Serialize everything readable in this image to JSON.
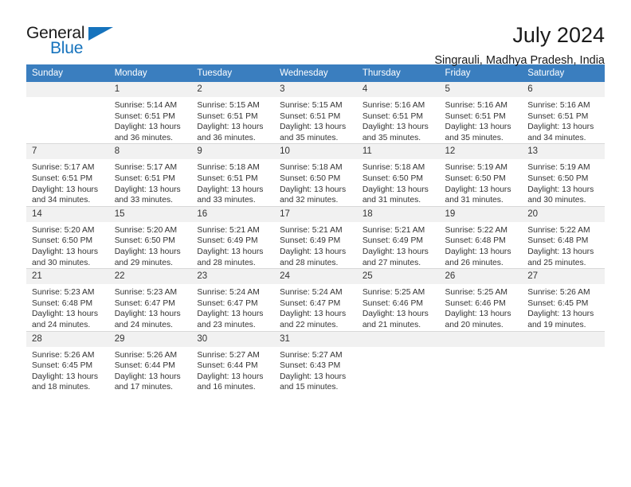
{
  "brand": {
    "word1": "General",
    "word2": "Blue",
    "triangle_color": "#1673bd"
  },
  "header": {
    "title": "July 2024",
    "subtitle": "Singrauli, Madhya Pradesh, India"
  },
  "calendar": {
    "header_bg": "#3a7ebf",
    "daynum_bg": "#f1f1f1",
    "weekdays": [
      "Sunday",
      "Monday",
      "Tuesday",
      "Wednesday",
      "Thursday",
      "Friday",
      "Saturday"
    ],
    "weeks": [
      [
        {
          "day": "",
          "lines": []
        },
        {
          "day": "1",
          "lines": [
            "Sunrise: 5:14 AM",
            "Sunset: 6:51 PM",
            "Daylight: 13 hours",
            "and 36 minutes."
          ]
        },
        {
          "day": "2",
          "lines": [
            "Sunrise: 5:15 AM",
            "Sunset: 6:51 PM",
            "Daylight: 13 hours",
            "and 36 minutes."
          ]
        },
        {
          "day": "3",
          "lines": [
            "Sunrise: 5:15 AM",
            "Sunset: 6:51 PM",
            "Daylight: 13 hours",
            "and 35 minutes."
          ]
        },
        {
          "day": "4",
          "lines": [
            "Sunrise: 5:16 AM",
            "Sunset: 6:51 PM",
            "Daylight: 13 hours",
            "and 35 minutes."
          ]
        },
        {
          "day": "5",
          "lines": [
            "Sunrise: 5:16 AM",
            "Sunset: 6:51 PM",
            "Daylight: 13 hours",
            "and 35 minutes."
          ]
        },
        {
          "day": "6",
          "lines": [
            "Sunrise: 5:16 AM",
            "Sunset: 6:51 PM",
            "Daylight: 13 hours",
            "and 34 minutes."
          ]
        }
      ],
      [
        {
          "day": "7",
          "lines": [
            "Sunrise: 5:17 AM",
            "Sunset: 6:51 PM",
            "Daylight: 13 hours",
            "and 34 minutes."
          ]
        },
        {
          "day": "8",
          "lines": [
            "Sunrise: 5:17 AM",
            "Sunset: 6:51 PM",
            "Daylight: 13 hours",
            "and 33 minutes."
          ]
        },
        {
          "day": "9",
          "lines": [
            "Sunrise: 5:18 AM",
            "Sunset: 6:51 PM",
            "Daylight: 13 hours",
            "and 33 minutes."
          ]
        },
        {
          "day": "10",
          "lines": [
            "Sunrise: 5:18 AM",
            "Sunset: 6:50 PM",
            "Daylight: 13 hours",
            "and 32 minutes."
          ]
        },
        {
          "day": "11",
          "lines": [
            "Sunrise: 5:18 AM",
            "Sunset: 6:50 PM",
            "Daylight: 13 hours",
            "and 31 minutes."
          ]
        },
        {
          "day": "12",
          "lines": [
            "Sunrise: 5:19 AM",
            "Sunset: 6:50 PM",
            "Daylight: 13 hours",
            "and 31 minutes."
          ]
        },
        {
          "day": "13",
          "lines": [
            "Sunrise: 5:19 AM",
            "Sunset: 6:50 PM",
            "Daylight: 13 hours",
            "and 30 minutes."
          ]
        }
      ],
      [
        {
          "day": "14",
          "lines": [
            "Sunrise: 5:20 AM",
            "Sunset: 6:50 PM",
            "Daylight: 13 hours",
            "and 30 minutes."
          ]
        },
        {
          "day": "15",
          "lines": [
            "Sunrise: 5:20 AM",
            "Sunset: 6:50 PM",
            "Daylight: 13 hours",
            "and 29 minutes."
          ]
        },
        {
          "day": "16",
          "lines": [
            "Sunrise: 5:21 AM",
            "Sunset: 6:49 PM",
            "Daylight: 13 hours",
            "and 28 minutes."
          ]
        },
        {
          "day": "17",
          "lines": [
            "Sunrise: 5:21 AM",
            "Sunset: 6:49 PM",
            "Daylight: 13 hours",
            "and 28 minutes."
          ]
        },
        {
          "day": "18",
          "lines": [
            "Sunrise: 5:21 AM",
            "Sunset: 6:49 PM",
            "Daylight: 13 hours",
            "and 27 minutes."
          ]
        },
        {
          "day": "19",
          "lines": [
            "Sunrise: 5:22 AM",
            "Sunset: 6:48 PM",
            "Daylight: 13 hours",
            "and 26 minutes."
          ]
        },
        {
          "day": "20",
          "lines": [
            "Sunrise: 5:22 AM",
            "Sunset: 6:48 PM",
            "Daylight: 13 hours",
            "and 25 minutes."
          ]
        }
      ],
      [
        {
          "day": "21",
          "lines": [
            "Sunrise: 5:23 AM",
            "Sunset: 6:48 PM",
            "Daylight: 13 hours",
            "and 24 minutes."
          ]
        },
        {
          "day": "22",
          "lines": [
            "Sunrise: 5:23 AM",
            "Sunset: 6:47 PM",
            "Daylight: 13 hours",
            "and 24 minutes."
          ]
        },
        {
          "day": "23",
          "lines": [
            "Sunrise: 5:24 AM",
            "Sunset: 6:47 PM",
            "Daylight: 13 hours",
            "and 23 minutes."
          ]
        },
        {
          "day": "24",
          "lines": [
            "Sunrise: 5:24 AM",
            "Sunset: 6:47 PM",
            "Daylight: 13 hours",
            "and 22 minutes."
          ]
        },
        {
          "day": "25",
          "lines": [
            "Sunrise: 5:25 AM",
            "Sunset: 6:46 PM",
            "Daylight: 13 hours",
            "and 21 minutes."
          ]
        },
        {
          "day": "26",
          "lines": [
            "Sunrise: 5:25 AM",
            "Sunset: 6:46 PM",
            "Daylight: 13 hours",
            "and 20 minutes."
          ]
        },
        {
          "day": "27",
          "lines": [
            "Sunrise: 5:26 AM",
            "Sunset: 6:45 PM",
            "Daylight: 13 hours",
            "and 19 minutes."
          ]
        }
      ],
      [
        {
          "day": "28",
          "lines": [
            "Sunrise: 5:26 AM",
            "Sunset: 6:45 PM",
            "Daylight: 13 hours",
            "and 18 minutes."
          ]
        },
        {
          "day": "29",
          "lines": [
            "Sunrise: 5:26 AM",
            "Sunset: 6:44 PM",
            "Daylight: 13 hours",
            "and 17 minutes."
          ]
        },
        {
          "day": "30",
          "lines": [
            "Sunrise: 5:27 AM",
            "Sunset: 6:44 PM",
            "Daylight: 13 hours",
            "and 16 minutes."
          ]
        },
        {
          "day": "31",
          "lines": [
            "Sunrise: 5:27 AM",
            "Sunset: 6:43 PM",
            "Daylight: 13 hours",
            "and 15 minutes."
          ]
        },
        {
          "day": "",
          "lines": []
        },
        {
          "day": "",
          "lines": []
        },
        {
          "day": "",
          "lines": []
        }
      ]
    ]
  }
}
